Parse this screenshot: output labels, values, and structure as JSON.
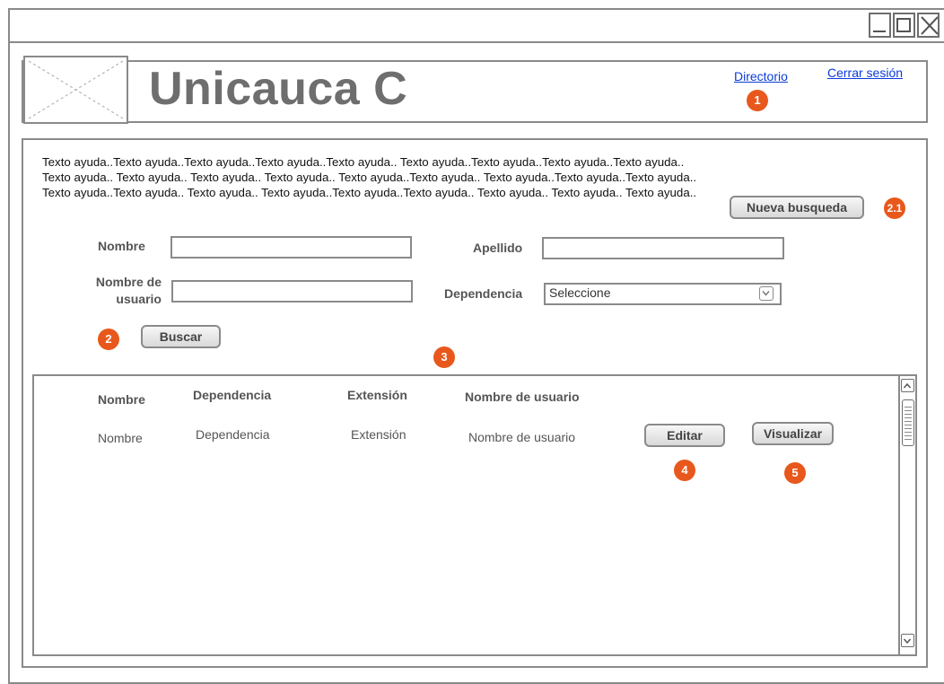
{
  "header": {
    "app_title": "Unicauca C",
    "directorio_link": "Directorio",
    "logout_link": "Cerrar sesión"
  },
  "markers": {
    "m1": "1",
    "m2": "2",
    "m21": "2.1",
    "m3": "3",
    "m4": "4",
    "m5": "5"
  },
  "help_text": "Texto ayuda..Texto ayuda..Texto ayuda..Texto ayuda..Texto ayuda.. Texto ayuda..Texto ayuda..Texto ayuda..Texto ayuda.. Texto ayuda.. Texto ayuda.. Texto ayuda.. Texto ayuda.. Texto ayuda..Texto ayuda.. Texto ayuda..Texto ayuda..Texto ayuda..  Texto ayuda..Texto ayuda.. Texto ayuda..  Texto ayuda..Texto ayuda..Texto ayuda.. Texto ayuda.. Texto ayuda.. Texto ayuda..",
  "search_form": {
    "new_search_label": "Nueva busqueda",
    "nombre_label": "Nombre",
    "nombre_value": "",
    "apellido_label": "Apellido",
    "apellido_value": "",
    "usuario_label_line1": "Nombre de",
    "usuario_label_line2": "usuario",
    "usuario_value": "",
    "dependencia_label": "Dependencia",
    "dependencia_selected": "Seleccione",
    "buscar_label": "Buscar"
  },
  "results": {
    "headers": [
      "Nombre",
      "Dependencia",
      "Extensión",
      "Nombre de usuario"
    ],
    "rows": [
      {
        "nombre": "Nombre",
        "dependencia": "Dependencia",
        "extension": "Extensión",
        "usuario": "Nombre de usuario",
        "edit_label": "Editar",
        "view_label": "Visualizar"
      }
    ]
  }
}
